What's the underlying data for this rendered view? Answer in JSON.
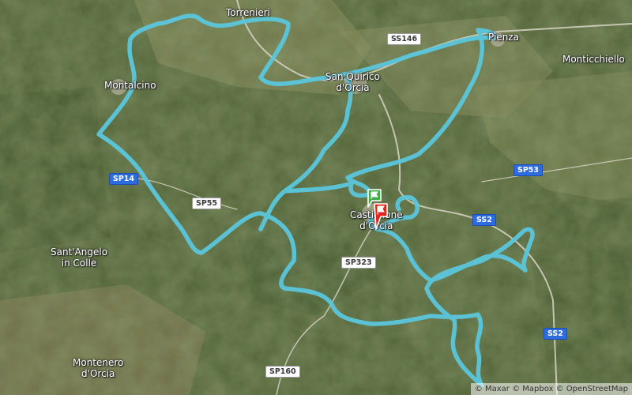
{
  "places": {
    "torrenieri": "Torrenieri",
    "montalcino": "Montalcino",
    "san_quirico_1": "San Quirico",
    "san_quirico_2": "d'Orcia",
    "castiglione_1": "Castiglione",
    "castiglione_2": "d'Orcia",
    "pienza": "Pienza",
    "monticchiello": "Monticchiello",
    "sant_angelo_1": "Sant'Angelo",
    "sant_angelo_2": "in Colle",
    "montenero_1": "Montenero",
    "montenero_2": "d'Orcia"
  },
  "roads": {
    "ss146": "SS146",
    "sp14": "SP14",
    "sp55": "SP55",
    "sp53": "SP53",
    "ss2_east": "SS2",
    "sp323": "SP323",
    "ss2_south": "SS2",
    "sp160": "SP160"
  },
  "attribution": "© Maxar © Mapbox © OpenStreetMap",
  "colors": {
    "route": "#5bc6dc",
    "start_flag": "#3fae49",
    "end_flag": "#e2231a",
    "road_badge_blue": "#2d6cdf"
  },
  "markers": {
    "start": "start-flag-icon",
    "end": "finish-flag-icon"
  }
}
